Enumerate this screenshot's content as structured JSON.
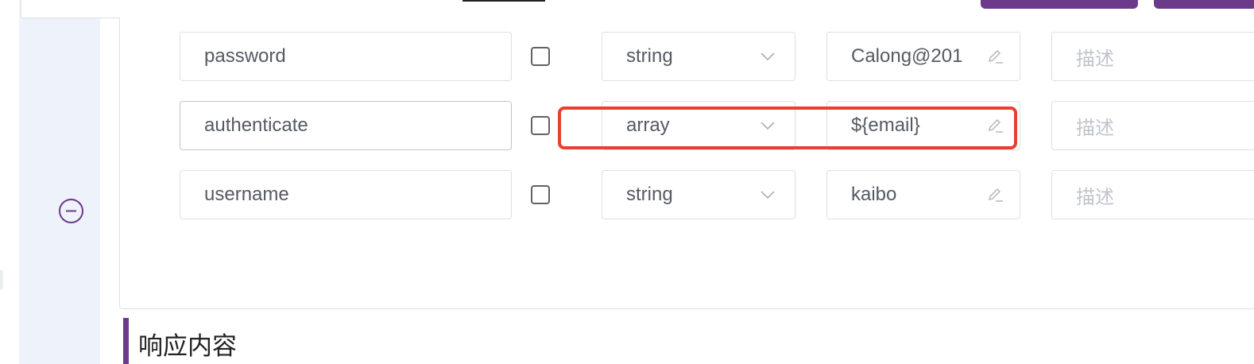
{
  "params": {
    "rows": [
      {
        "name": "password",
        "required": false,
        "type": "string",
        "value": "Calong@201",
        "description_placeholder": "描述"
      },
      {
        "name": "authenticate",
        "required": false,
        "type": "array",
        "value": "${email}",
        "description_placeholder": "描述"
      },
      {
        "name": "username",
        "required": false,
        "type": "string",
        "value": "kaibo",
        "description_placeholder": "描述"
      }
    ]
  },
  "section": {
    "title": "响应内容"
  },
  "colors": {
    "accent": "#6b3a8a",
    "highlight": "#e54030"
  }
}
